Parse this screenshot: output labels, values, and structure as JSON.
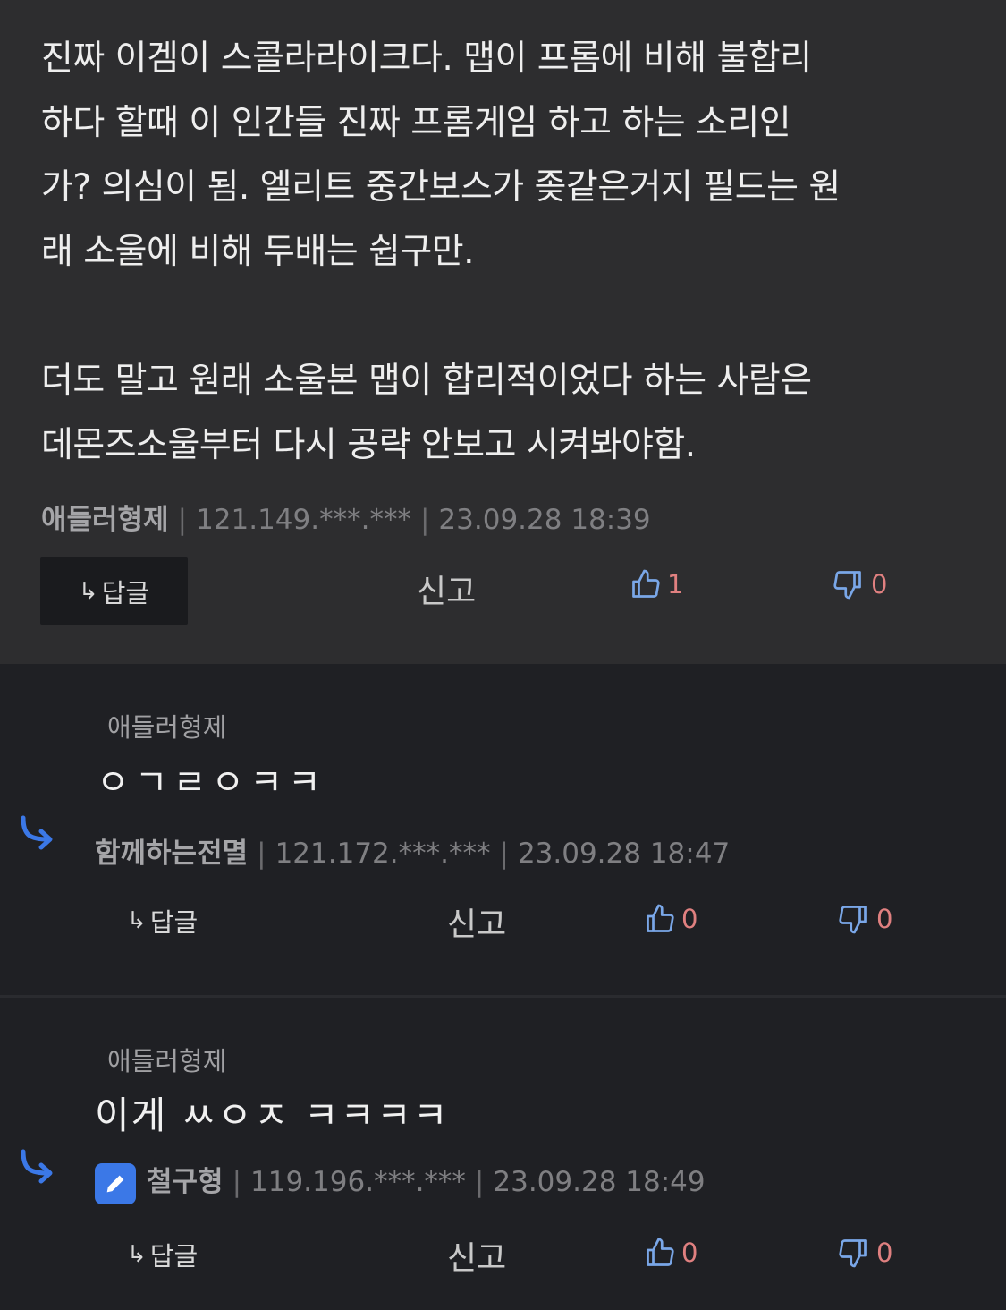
{
  "main_comment": {
    "text": "진짜 이겜이 스콜라라이크다. 맵이 프롬에 비해 불합리\n하다 할때 이 인간들 진짜 프롬게임 하고 하는 소리인\n가? 의심이 됨. 엘리트 중간보스가 좆같은거지 필드는 원\n래 소울에 비해 두배는 쉽구만.\n\n더도 말고 원래 소울본 맵이 합리적이었다 하는 사람은\n데몬즈소울부터 다시 공략 안보고 시켜봐야함.",
    "author": "애들러형제",
    "ip": "121.149.***.***",
    "time": "23.09.28 18:39",
    "reply_label": "답글",
    "report_label": "신고",
    "likes": "1",
    "dislikes": "0"
  },
  "replies": [
    {
      "target": "애들러형제",
      "text": "ㅇㄱㄹㅇㅋㅋ",
      "author": "함께하는전멸",
      "ip": "121.172.***.***",
      "time": "23.09.28 18:47",
      "reply_label": "답글",
      "report_label": "신고",
      "likes": "0",
      "dislikes": "0"
    },
    {
      "target": "애들러형제",
      "text": "이게 ㅆㅇㅈ ㅋㅋㅋㅋ",
      "author": "철구형",
      "ip": "119.196.***.***",
      "time": "23.09.28 18:49",
      "reply_label": "답글",
      "report_label": "신고",
      "likes": "0",
      "dislikes": "0",
      "badge_icon": "pencil-icon"
    }
  ],
  "colors": {
    "main_bg": "#2d2d2f",
    "page_bg": "#1f2024",
    "accent_blue": "#3b78e7",
    "vote_count": "#e08080"
  }
}
